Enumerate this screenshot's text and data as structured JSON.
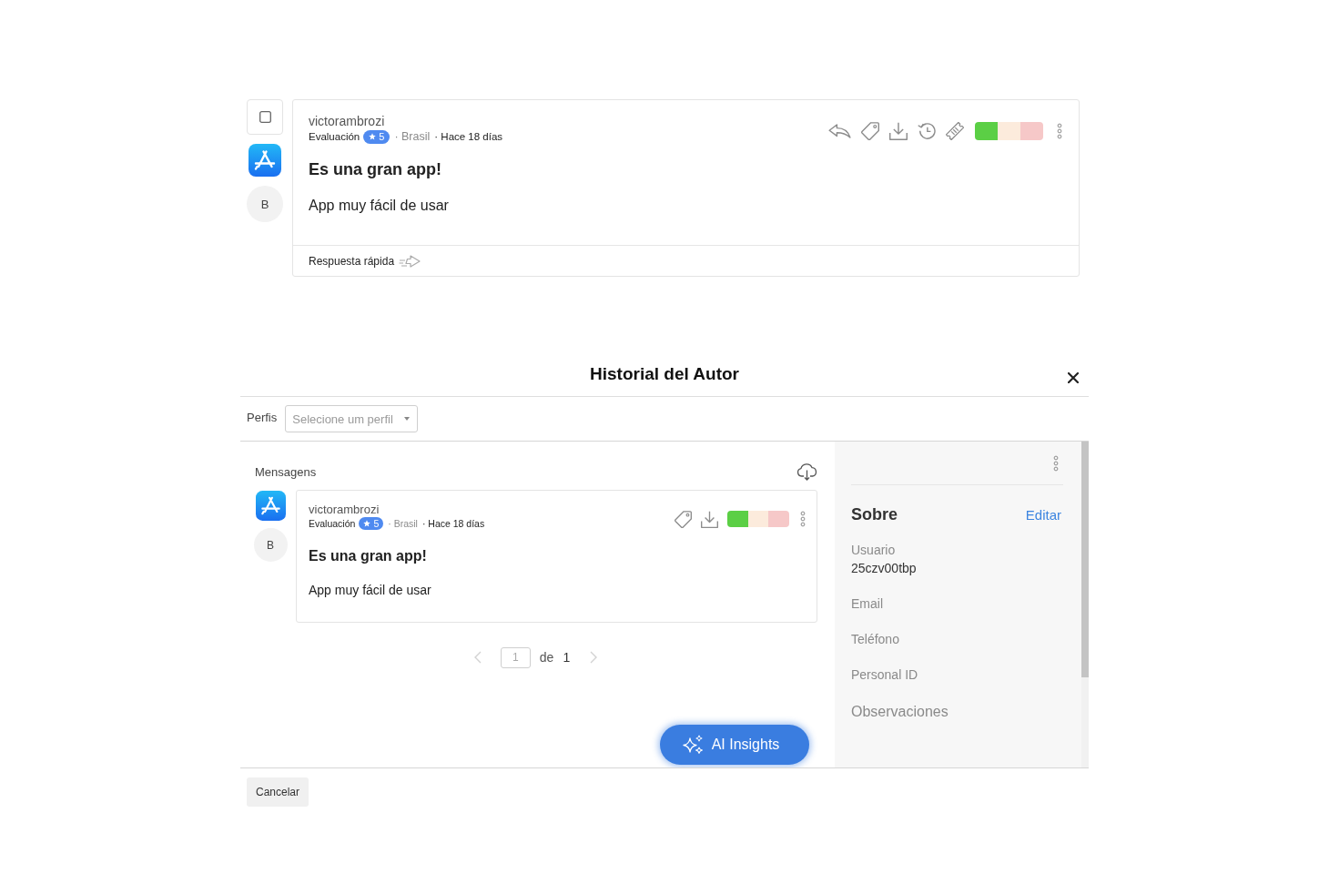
{
  "review_card": {
    "checked": false,
    "avatar_letter": "B",
    "author": "victorambrozi",
    "rating_label": "Evaluación",
    "rating": "5",
    "country": "· Brasil",
    "time": "· Hace 18 días",
    "sentiment": [
      {
        "color": "#5bcf45"
      },
      {
        "color": "#fcebdc"
      },
      {
        "color": "#f6c8c8"
      }
    ],
    "title": "Es una gran app!",
    "body": "App muy fácil de usar",
    "quick_reply": "Respuesta rápida"
  },
  "modal": {
    "title": "Historial del Autor",
    "profiles": {
      "label": "Perfis",
      "placeholder": "Selecione um perfil"
    },
    "messages": {
      "heading": "Mensagens",
      "items": [
        {
          "avatar_letter": "B",
          "author": "victorambrozi",
          "rating_label": "Evaluación",
          "rating": "5",
          "country": "· Brasil",
          "time": "· Hace 18 días",
          "sentiment": [
            {
              "color": "#5bcf45"
            },
            {
              "color": "#fcebdc"
            },
            {
              "color": "#f6c8c8"
            }
          ],
          "title": "Es una gran app!",
          "body": "App muy fácil de usar"
        }
      ],
      "pagination": {
        "page": "1",
        "of_label": "de",
        "total": "1",
        "prev_disabled": true,
        "next_disabled": true
      }
    },
    "ai_button": "AI Insights",
    "about": {
      "heading": "Sobre",
      "edit_link": "Editar",
      "fields": [
        {
          "kind": "field",
          "label": "Usuario",
          "value": "25czv00tbp"
        },
        {
          "kind": "field",
          "label": "Email"
        },
        {
          "kind": "field",
          "label": "Teléfono"
        },
        {
          "kind": "field",
          "label": "Personal ID"
        },
        {
          "kind": "notes",
          "label": "Observaciones"
        }
      ]
    },
    "cancel_button": "Cancelar"
  }
}
